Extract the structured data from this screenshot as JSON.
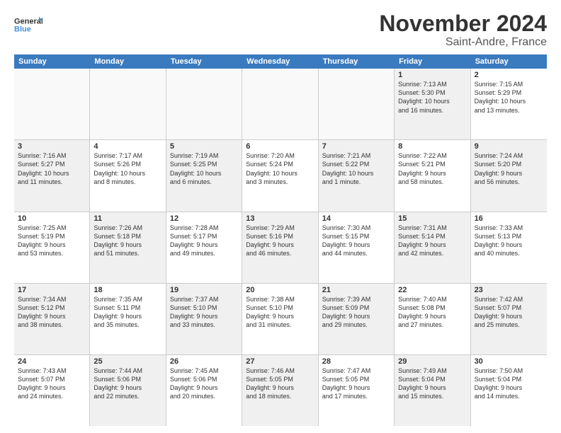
{
  "logo": {
    "line1": "General",
    "line2": "Blue"
  },
  "title": "November 2024",
  "subtitle": "Saint-Andre, France",
  "weekdays": [
    "Sunday",
    "Monday",
    "Tuesday",
    "Wednesday",
    "Thursday",
    "Friday",
    "Saturday"
  ],
  "rows": [
    [
      {
        "day": "",
        "info": "",
        "empty": true
      },
      {
        "day": "",
        "info": "",
        "empty": true
      },
      {
        "day": "",
        "info": "",
        "empty": true
      },
      {
        "day": "",
        "info": "",
        "empty": true
      },
      {
        "day": "",
        "info": "",
        "empty": true
      },
      {
        "day": "1",
        "info": "Sunrise: 7:13 AM\nSunset: 5:30 PM\nDaylight: 10 hours\nand 16 minutes.",
        "shaded": true
      },
      {
        "day": "2",
        "info": "Sunrise: 7:15 AM\nSunset: 5:29 PM\nDaylight: 10 hours\nand 13 minutes.",
        "shaded": false
      }
    ],
    [
      {
        "day": "3",
        "info": "Sunrise: 7:16 AM\nSunset: 5:27 PM\nDaylight: 10 hours\nand 11 minutes.",
        "shaded": true
      },
      {
        "day": "4",
        "info": "Sunrise: 7:17 AM\nSunset: 5:26 PM\nDaylight: 10 hours\nand 8 minutes.",
        "shaded": false
      },
      {
        "day": "5",
        "info": "Sunrise: 7:19 AM\nSunset: 5:25 PM\nDaylight: 10 hours\nand 6 minutes.",
        "shaded": true
      },
      {
        "day": "6",
        "info": "Sunrise: 7:20 AM\nSunset: 5:24 PM\nDaylight: 10 hours\nand 3 minutes.",
        "shaded": false
      },
      {
        "day": "7",
        "info": "Sunrise: 7:21 AM\nSunset: 5:22 PM\nDaylight: 10 hours\nand 1 minute.",
        "shaded": true
      },
      {
        "day": "8",
        "info": "Sunrise: 7:22 AM\nSunset: 5:21 PM\nDaylight: 9 hours\nand 58 minutes.",
        "shaded": false
      },
      {
        "day": "9",
        "info": "Sunrise: 7:24 AM\nSunset: 5:20 PM\nDaylight: 9 hours\nand 56 minutes.",
        "shaded": true
      }
    ],
    [
      {
        "day": "10",
        "info": "Sunrise: 7:25 AM\nSunset: 5:19 PM\nDaylight: 9 hours\nand 53 minutes.",
        "shaded": false
      },
      {
        "day": "11",
        "info": "Sunrise: 7:26 AM\nSunset: 5:18 PM\nDaylight: 9 hours\nand 51 minutes.",
        "shaded": true
      },
      {
        "day": "12",
        "info": "Sunrise: 7:28 AM\nSunset: 5:17 PM\nDaylight: 9 hours\nand 49 minutes.",
        "shaded": false
      },
      {
        "day": "13",
        "info": "Sunrise: 7:29 AM\nSunset: 5:16 PM\nDaylight: 9 hours\nand 46 minutes.",
        "shaded": true
      },
      {
        "day": "14",
        "info": "Sunrise: 7:30 AM\nSunset: 5:15 PM\nDaylight: 9 hours\nand 44 minutes.",
        "shaded": false
      },
      {
        "day": "15",
        "info": "Sunrise: 7:31 AM\nSunset: 5:14 PM\nDaylight: 9 hours\nand 42 minutes.",
        "shaded": true
      },
      {
        "day": "16",
        "info": "Sunrise: 7:33 AM\nSunset: 5:13 PM\nDaylight: 9 hours\nand 40 minutes.",
        "shaded": false
      }
    ],
    [
      {
        "day": "17",
        "info": "Sunrise: 7:34 AM\nSunset: 5:12 PM\nDaylight: 9 hours\nand 38 minutes.",
        "shaded": true
      },
      {
        "day": "18",
        "info": "Sunrise: 7:35 AM\nSunset: 5:11 PM\nDaylight: 9 hours\nand 35 minutes.",
        "shaded": false
      },
      {
        "day": "19",
        "info": "Sunrise: 7:37 AM\nSunset: 5:10 PM\nDaylight: 9 hours\nand 33 minutes.",
        "shaded": true
      },
      {
        "day": "20",
        "info": "Sunrise: 7:38 AM\nSunset: 5:10 PM\nDaylight: 9 hours\nand 31 minutes.",
        "shaded": false
      },
      {
        "day": "21",
        "info": "Sunrise: 7:39 AM\nSunset: 5:09 PM\nDaylight: 9 hours\nand 29 minutes.",
        "shaded": true
      },
      {
        "day": "22",
        "info": "Sunrise: 7:40 AM\nSunset: 5:08 PM\nDaylight: 9 hours\nand 27 minutes.",
        "shaded": false
      },
      {
        "day": "23",
        "info": "Sunrise: 7:42 AM\nSunset: 5:07 PM\nDaylight: 9 hours\nand 25 minutes.",
        "shaded": true
      }
    ],
    [
      {
        "day": "24",
        "info": "Sunrise: 7:43 AM\nSunset: 5:07 PM\nDaylight: 9 hours\nand 24 minutes.",
        "shaded": false
      },
      {
        "day": "25",
        "info": "Sunrise: 7:44 AM\nSunset: 5:06 PM\nDaylight: 9 hours\nand 22 minutes.",
        "shaded": true
      },
      {
        "day": "26",
        "info": "Sunrise: 7:45 AM\nSunset: 5:06 PM\nDaylight: 9 hours\nand 20 minutes.",
        "shaded": false
      },
      {
        "day": "27",
        "info": "Sunrise: 7:46 AM\nSunset: 5:05 PM\nDaylight: 9 hours\nand 18 minutes.",
        "shaded": true
      },
      {
        "day": "28",
        "info": "Sunrise: 7:47 AM\nSunset: 5:05 PM\nDaylight: 9 hours\nand 17 minutes.",
        "shaded": false
      },
      {
        "day": "29",
        "info": "Sunrise: 7:49 AM\nSunset: 5:04 PM\nDaylight: 9 hours\nand 15 minutes.",
        "shaded": true
      },
      {
        "day": "30",
        "info": "Sunrise: 7:50 AM\nSunset: 5:04 PM\nDaylight: 9 hours\nand 14 minutes.",
        "shaded": false
      }
    ]
  ]
}
